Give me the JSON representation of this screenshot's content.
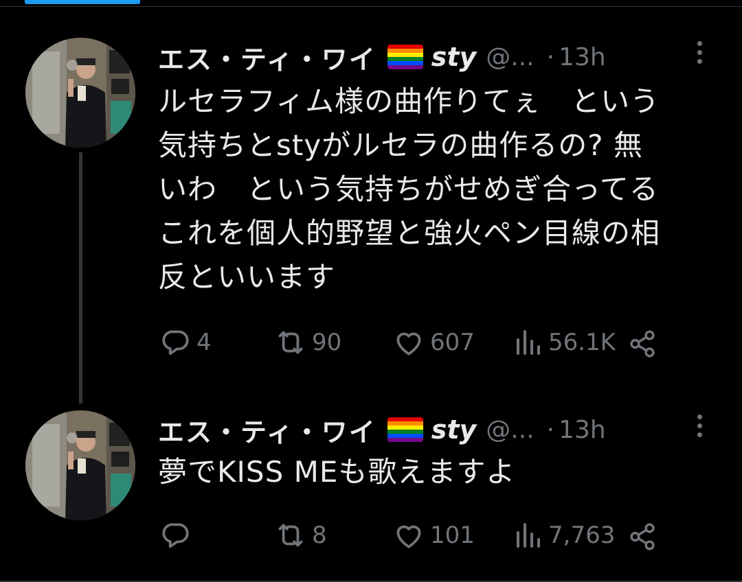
{
  "colors": {
    "background": "#000000",
    "text": "#e7e9ea",
    "muted": "#71767b",
    "accent": "#1d9bf0",
    "divider": "#2f3336"
  },
  "tweets": [
    {
      "author_name": "エス・ティ・ワイ",
      "author_emoji": "rainbow-flag",
      "author_suffix": "sty",
      "handle": "@...",
      "separator": "·",
      "time": "13h",
      "text_lines": [
        "ルセラフィム様の曲作りてぇ　という",
        "気持ちとstyがルセラの曲作るの? 無",
        "いわ　という気持ちがせめぎ合ってる",
        "これを個人的野望と強火ペン目線の相",
        "反といいます"
      ],
      "replies": "4",
      "retweets": "90",
      "likes": "607",
      "views": "56.1K"
    },
    {
      "author_name": "エス・ティ・ワイ",
      "author_emoji": "rainbow-flag",
      "author_suffix": "sty",
      "handle": "@...",
      "separator": "·",
      "time": "13h",
      "text_lines": [
        "夢でKISS MEも歌えますよ"
      ],
      "replies": "",
      "retweets": "8",
      "likes": "101",
      "views": "7,763"
    }
  ],
  "icons": {
    "reply": "reply-icon",
    "retweet": "retweet-icon",
    "like": "heart-icon",
    "views": "views-icon",
    "share": "share-icon",
    "more": "more-icon"
  }
}
